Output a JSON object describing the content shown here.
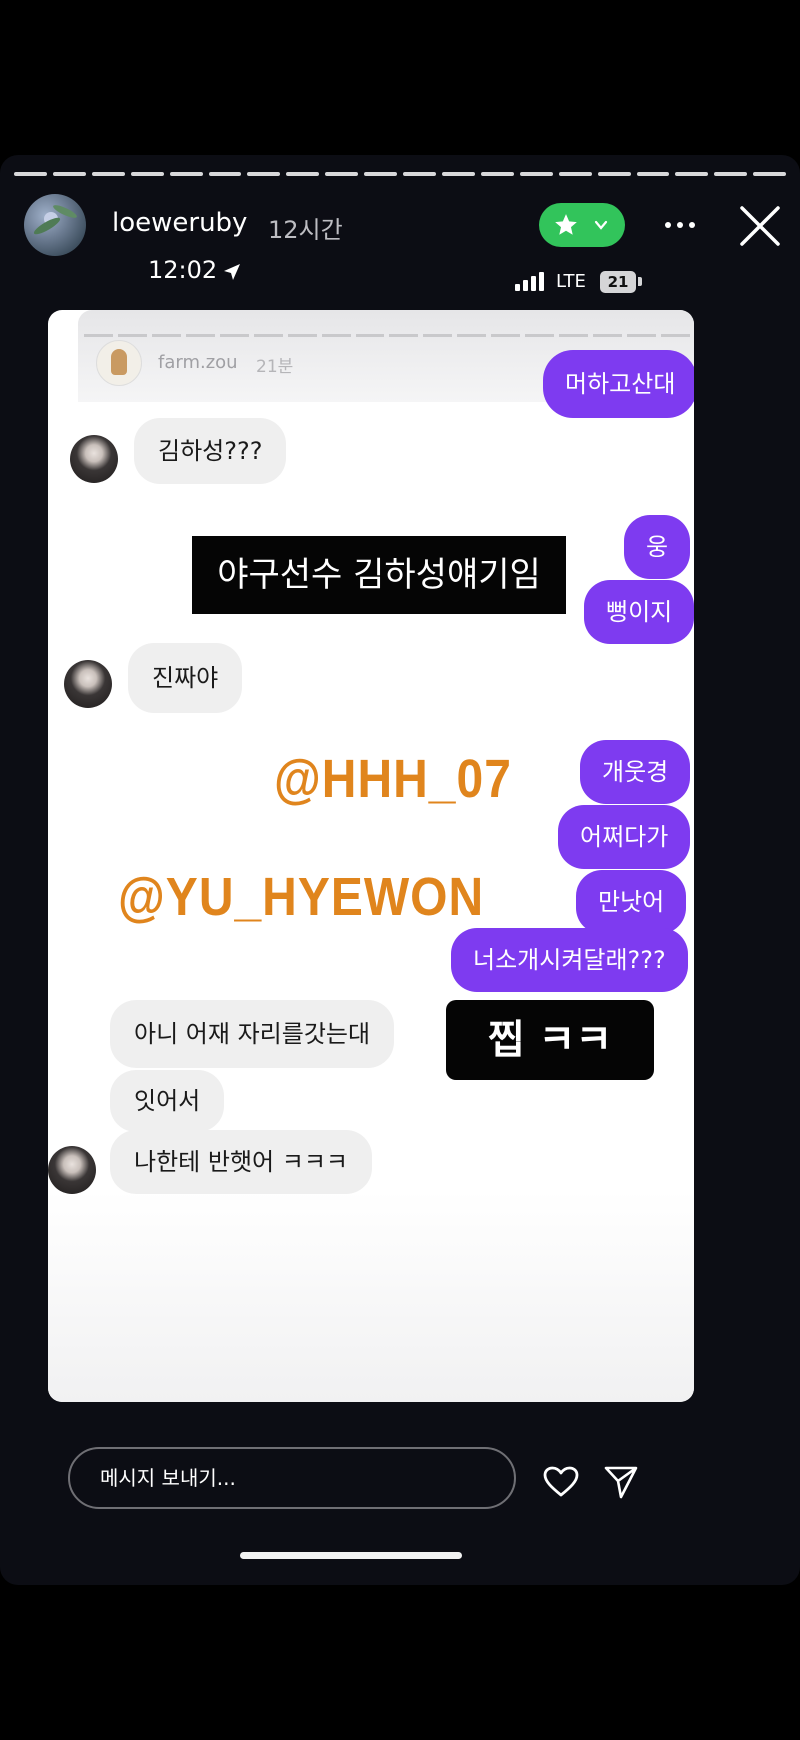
{
  "story": {
    "username": "loeweruby",
    "time_ago": "12시간",
    "clock": "12:02",
    "network": "LTE",
    "battery": "21",
    "progress_segments": 20,
    "progress_active": 20
  },
  "embedded": {
    "username": "farm.zou",
    "time_ago": "21분",
    "more_label": "•••",
    "messages": [
      {
        "side": "out",
        "text": "머하고산대"
      },
      {
        "side": "in",
        "text": "김하성???"
      },
      {
        "side": "out",
        "text": "웅"
      },
      {
        "side": "out",
        "text": "뻥이지"
      },
      {
        "side": "in",
        "text": "진짜야"
      },
      {
        "side": "out",
        "text": "개웃경"
      },
      {
        "side": "out",
        "text": "어쩌다가"
      },
      {
        "side": "out",
        "text": "만낫어"
      },
      {
        "side": "out",
        "text": "너소개시켜달래???"
      },
      {
        "side": "in",
        "text": "아니 어재 자리를갓는대"
      },
      {
        "side": "in",
        "text": "잇어서"
      },
      {
        "side": "in",
        "text": "나한테 반햇어 ㅋㅋㅋ"
      }
    ],
    "overlay_label_1": "야구선수 김하성얘기임",
    "overlay_label_2": "찝 ㅋㅋ",
    "mention_1": "@HHH_07",
    "mention_2": "@YU_HYEWON"
  },
  "footer": {
    "message_placeholder": "메시지 보내기..."
  },
  "colors": {
    "outgoing_bubble": "#7e3bf0",
    "incoming_bubble": "#efefef",
    "close_friends": "#32c45b",
    "mention": "#e0851d"
  }
}
